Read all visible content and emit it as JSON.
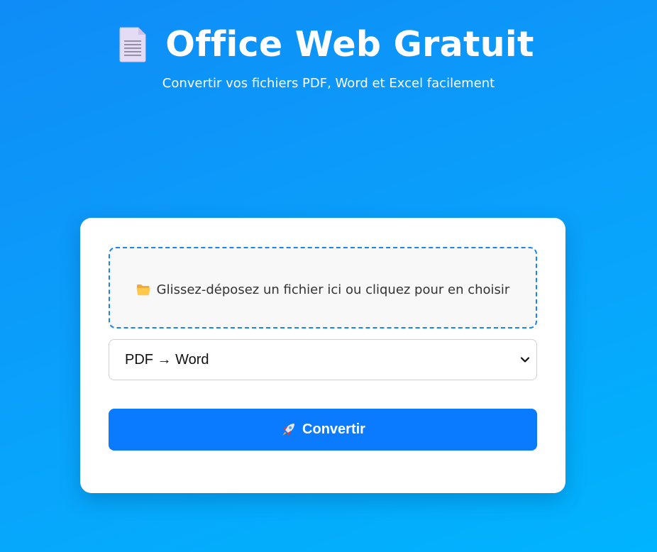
{
  "header": {
    "title": "Office Web Gratuit",
    "subtitle": "Convertir vos fichiers PDF, Word et Excel facilement",
    "icon": "document-icon"
  },
  "upload": {
    "icon": "folder-icon",
    "prompt": "Glissez-déposez un fichier ici ou cliquez pour en choisir"
  },
  "conversion": {
    "selected": "PDF → Word"
  },
  "convert_button": {
    "icon": "rocket-icon",
    "label": "Convertir"
  },
  "colors": {
    "background_start": "#0f8cf7",
    "background_end": "#00b4fd",
    "accent": "#0a7bff",
    "dropzone_border": "#1a86e8"
  }
}
